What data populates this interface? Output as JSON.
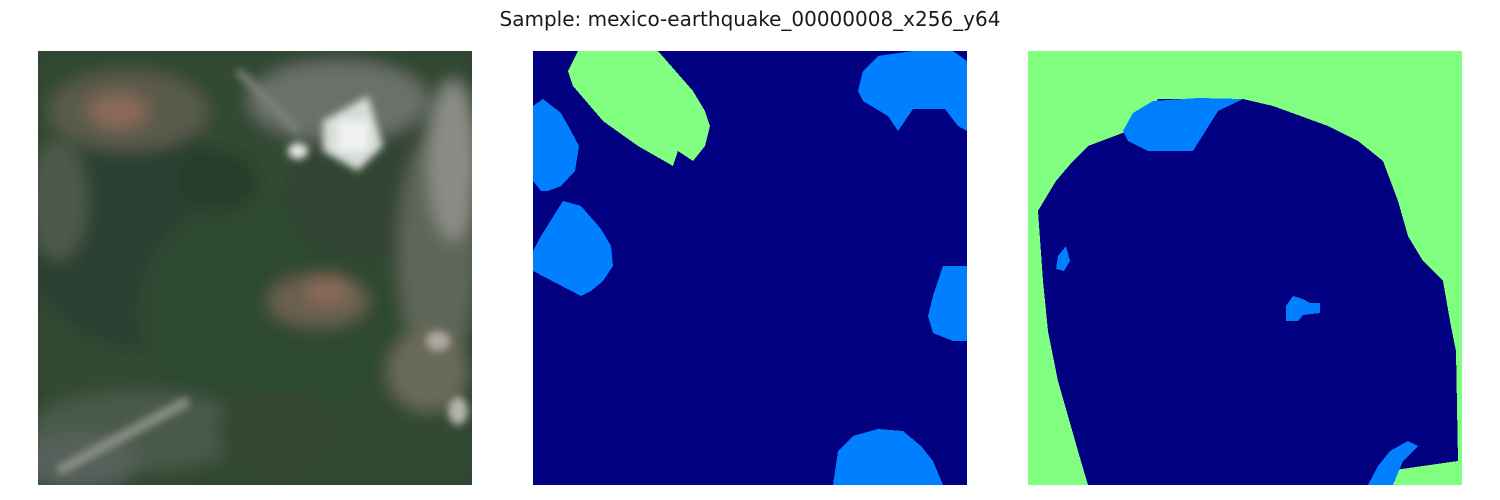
{
  "figure": {
    "title": "Sample: mexico-earthquake_00000008_x256_y64"
  },
  "panels": [
    {
      "name": "satellite-image"
    },
    {
      "name": "mask-a",
      "colors": {
        "background": "#000080",
        "class_1": "#0080ff",
        "class_2": "#80ff80"
      }
    },
    {
      "name": "mask-b",
      "colors": {
        "background": "#000080",
        "class_1": "#0080ff",
        "class_2": "#80ff80"
      }
    }
  ]
}
